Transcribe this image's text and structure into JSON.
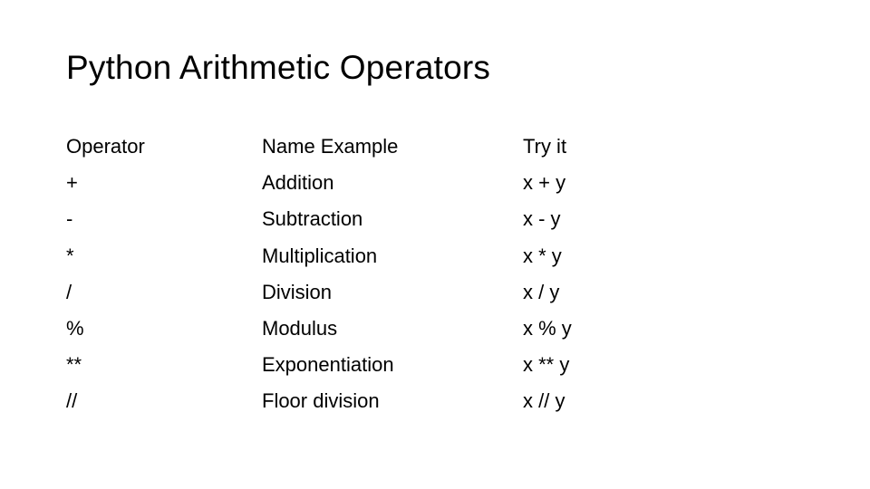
{
  "slide": {
    "title": "Python Arithmetic Operators",
    "columns": {
      "operator": {
        "header": "Operator",
        "items": [
          "+",
          "-",
          "*",
          "/",
          "%",
          "**",
          "//"
        ]
      },
      "name": {
        "header": "Name Example",
        "items": [
          "Addition",
          "Subtraction",
          "Multiplication",
          "Division",
          "Modulus",
          "Exponentiation",
          "Floor division"
        ]
      },
      "example": {
        "header": "Try it",
        "items": [
          "x + y",
          "x - y",
          "x * y",
          "x / y",
          "x % y",
          "x ** y",
          "x // y"
        ]
      }
    }
  }
}
